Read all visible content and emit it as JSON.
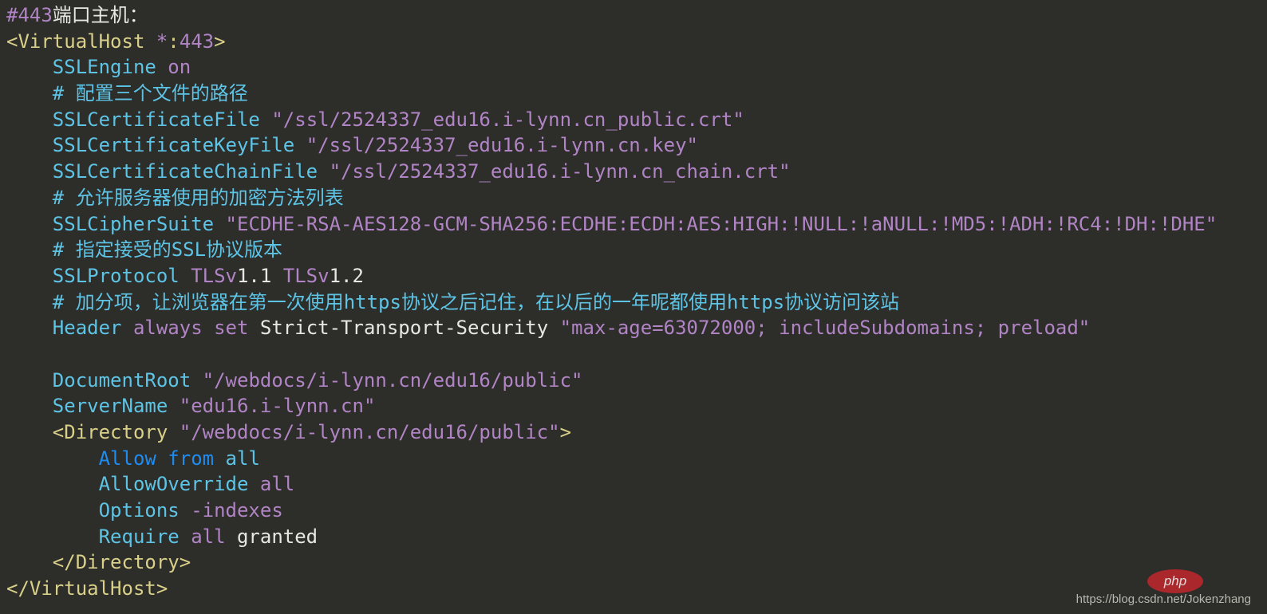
{
  "colors": {
    "directive": "#5ec4e6",
    "value": "#b184c6",
    "tag": "#d9d08a",
    "text": "#e8e8e2",
    "keyword": "#1e8cf0",
    "background": "#2d2d29"
  },
  "code_lines": [
    [
      [
        "p",
        "#443"
      ],
      [
        "w",
        "端口主机："
      ]
    ],
    [
      [
        "y",
        "<VirtualHost "
      ],
      [
        "p",
        "*"
      ],
      [
        "y",
        ":"
      ],
      [
        "p",
        "443"
      ],
      [
        "y",
        ">"
      ]
    ],
    [
      [
        "w",
        "    "
      ],
      [
        "k",
        "SSLEngine "
      ],
      [
        "p",
        "on"
      ]
    ],
    [
      [
        "w",
        "    "
      ],
      [
        "c",
        "# 配置三个文件的路径"
      ]
    ],
    [
      [
        "w",
        "    "
      ],
      [
        "k",
        "SSLCertificateFile "
      ],
      [
        "p",
        "\"/ssl/2524337_edu16.i-lynn.cn_public.crt\""
      ]
    ],
    [
      [
        "w",
        "    "
      ],
      [
        "k",
        "SSLCertificateKeyFile "
      ],
      [
        "p",
        "\"/ssl/2524337_edu16.i-lynn.cn.key\""
      ]
    ],
    [
      [
        "w",
        "    "
      ],
      [
        "k",
        "SSLCertificateChainFile "
      ],
      [
        "p",
        "\"/ssl/2524337_edu16.i-lynn.cn_chain.crt\""
      ]
    ],
    [
      [
        "w",
        "    "
      ],
      [
        "c",
        "# 允许服务器使用的加密方法列表"
      ]
    ],
    [
      [
        "w",
        "    "
      ],
      [
        "k",
        "SSLCipherSuite "
      ],
      [
        "p",
        "\"ECDHE-RSA-AES128-GCM-SHA256:ECDHE:ECDH:AES:HIGH:!NULL:!aNULL:!MD5:!ADH:!RC4:!DH:!DHE\""
      ]
    ],
    [
      [
        "w",
        "    "
      ],
      [
        "c",
        "# 指定接受的SSL协议版本"
      ]
    ],
    [
      [
        "w",
        "    "
      ],
      [
        "k",
        "SSLProtocol "
      ],
      [
        "p",
        "TLSv"
      ],
      [
        "w",
        "1.1 "
      ],
      [
        "p",
        "TLSv"
      ],
      [
        "w",
        "1.2"
      ]
    ],
    [
      [
        "w",
        "    "
      ],
      [
        "c",
        "# 加分项，让浏览器在第一次使用https协议之后记住，在以后的一年呢都使用https协议访问该站"
      ]
    ],
    [
      [
        "w",
        "    "
      ],
      [
        "k",
        "Header "
      ],
      [
        "p",
        "always set "
      ],
      [
        "w",
        "Strict-Transport-Security "
      ],
      [
        "p",
        "\"max-age=63072000; includeSubdomains; preload\""
      ]
    ],
    [
      [
        "w",
        " "
      ]
    ],
    [
      [
        "w",
        "    "
      ],
      [
        "k",
        "DocumentRoot "
      ],
      [
        "p",
        "\"/webdocs/i-lynn.cn/edu16/public\""
      ]
    ],
    [
      [
        "w",
        "    "
      ],
      [
        "k",
        "ServerName "
      ],
      [
        "p",
        "\"edu16.i-lynn.cn\""
      ]
    ],
    [
      [
        "w",
        "    "
      ],
      [
        "y",
        "<Directory "
      ],
      [
        "p",
        "\"/webdocs/i-lynn.cn/edu16/public\""
      ],
      [
        "y",
        ">"
      ]
    ],
    [
      [
        "w",
        "        "
      ],
      [
        "b",
        "Allow from "
      ],
      [
        "k",
        "all"
      ]
    ],
    [
      [
        "w",
        "        "
      ],
      [
        "k",
        "AllowOverride "
      ],
      [
        "p",
        "all"
      ]
    ],
    [
      [
        "w",
        "        "
      ],
      [
        "k",
        "Options "
      ],
      [
        "p",
        "-indexes"
      ]
    ],
    [
      [
        "w",
        "        "
      ],
      [
        "k",
        "Require "
      ],
      [
        "p",
        "all "
      ],
      [
        "w",
        "granted"
      ]
    ],
    [
      [
        "w",
        "    "
      ],
      [
        "y",
        "</Directory>"
      ]
    ],
    [
      [
        "y",
        "</VirtualHost>"
      ]
    ]
  ],
  "watermark": {
    "url": "https://blog.csdn.net/Jokenzhang",
    "logo": "php"
  }
}
